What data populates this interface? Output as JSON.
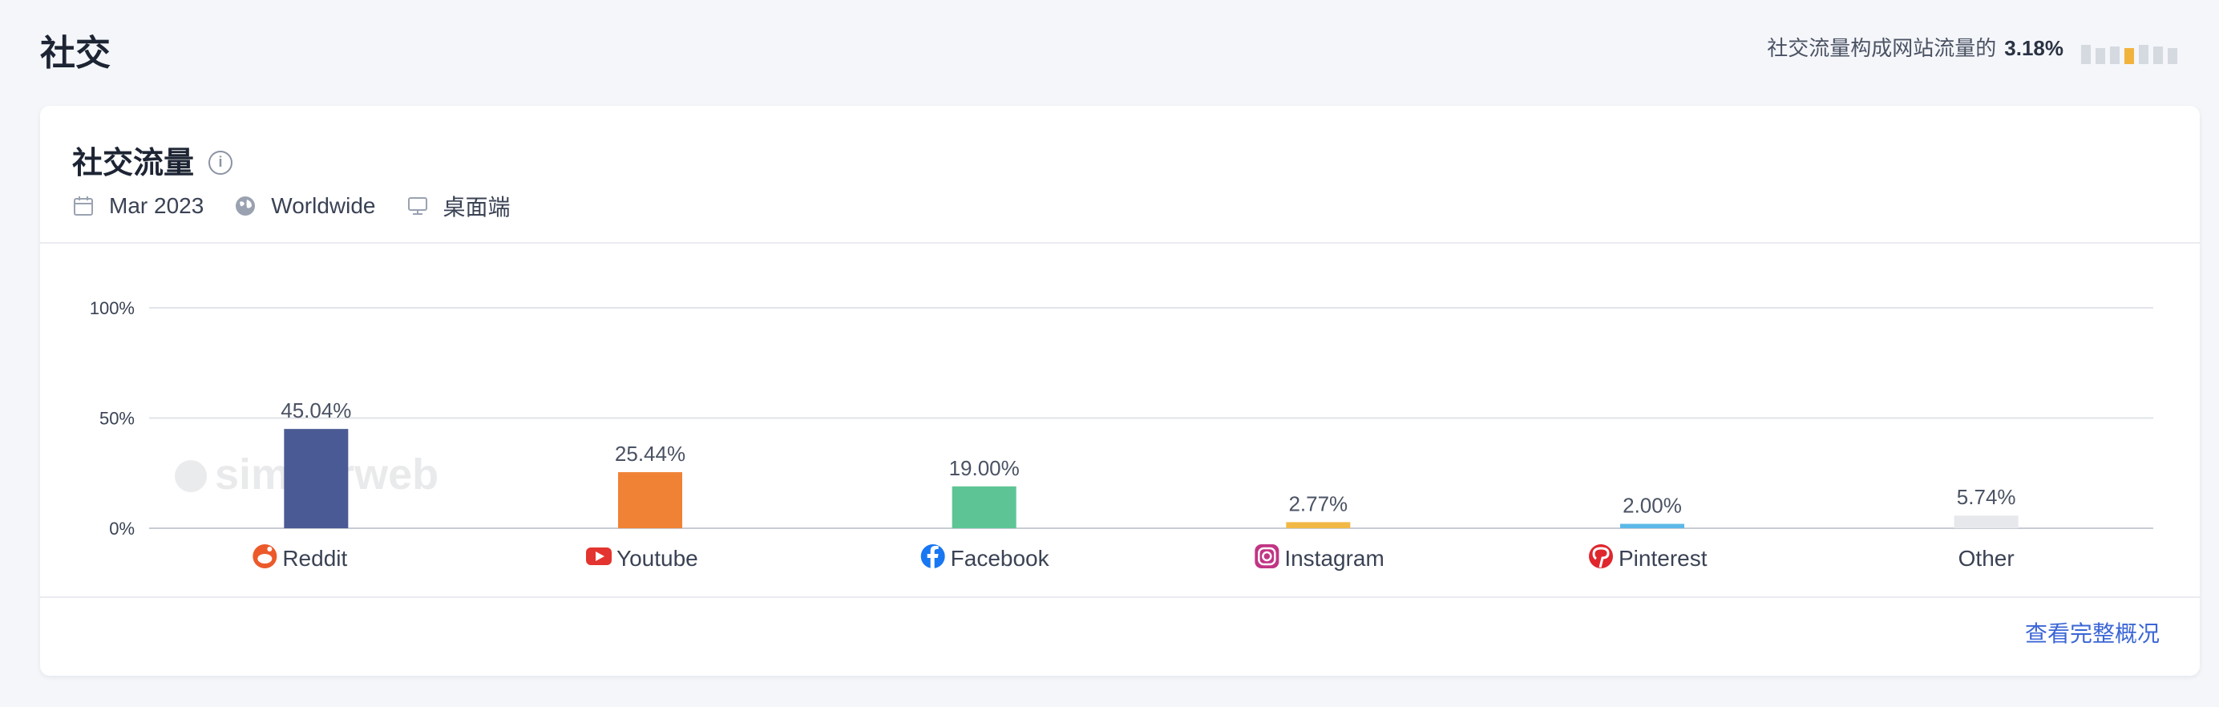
{
  "page": {
    "title": "社交",
    "share_text": "社交流量构成网站流量的",
    "share_value": "3.18%"
  },
  "mini_bars": [
    {
      "level": 0.55,
      "color": "#d5d9e0"
    },
    {
      "level": 0.45,
      "color": "#d5d9e0"
    },
    {
      "level": 0.5,
      "color": "#d5d9e0"
    },
    {
      "level": 0.45,
      "color": "#f2b33d"
    },
    {
      "level": 0.55,
      "color": "#d5d9e0"
    },
    {
      "level": 0.5,
      "color": "#d5d9e0"
    },
    {
      "level": 0.45,
      "color": "#d5d9e0"
    }
  ],
  "card": {
    "title": "社交流量",
    "date": "Mar 2023",
    "region": "Worldwide",
    "device": "桌面端",
    "full_overview_link": "查看完整概况",
    "watermark": "similarweb"
  },
  "chart_data": {
    "type": "bar",
    "categories": [
      "Reddit",
      "Youtube",
      "Facebook",
      "Instagram",
      "Pinterest",
      "Other"
    ],
    "values": [
      45.04,
      25.44,
      19.0,
      2.77,
      2.0,
      5.74
    ],
    "value_labels": [
      "45.04%",
      "25.44%",
      "19.00%",
      "2.77%",
      "2.00%",
      "5.74%"
    ],
    "colors": [
      "#4a5a94",
      "#f08236",
      "#5dc595",
      "#f2b846",
      "#5bb8e8",
      "#e6e8ec"
    ],
    "icons": [
      "reddit-icon",
      "youtube-icon",
      "facebook-icon",
      "instagram-icon",
      "pinterest-icon",
      ""
    ],
    "yticks": [
      0,
      50,
      100
    ],
    "ytick_labels": [
      "0%",
      "50%",
      "100%"
    ],
    "ylim": [
      0,
      100
    ],
    "grid": true
  }
}
